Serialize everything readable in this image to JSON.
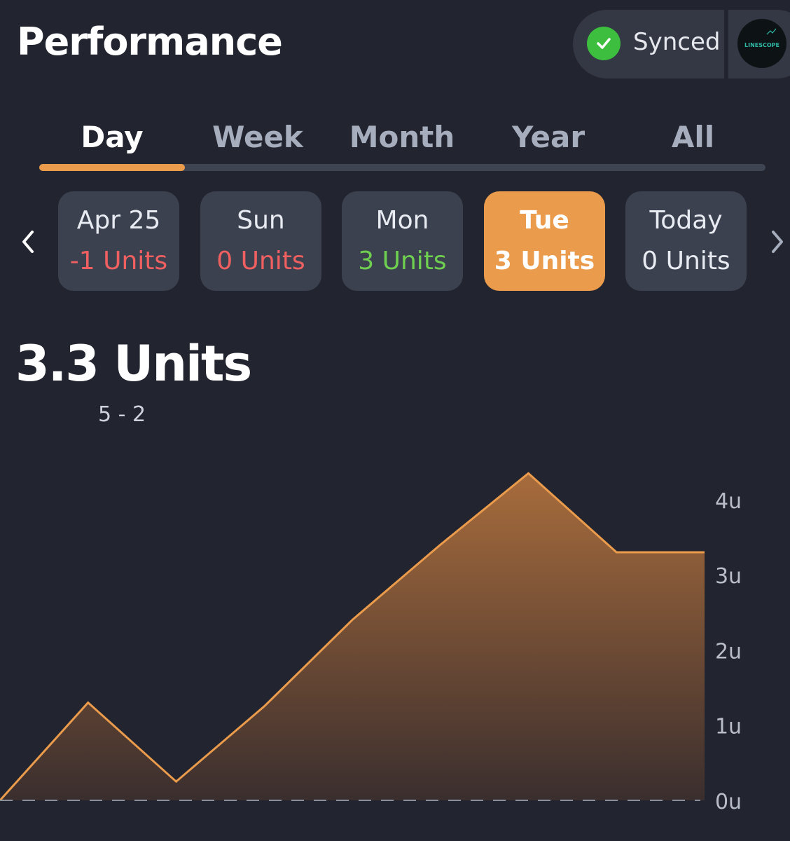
{
  "header": {
    "title": "Performance"
  },
  "sync": {
    "label": "Synced",
    "status_icon": "check-circle-icon",
    "status_color": "#3dbe3f"
  },
  "avatar": {
    "text": "LINESCOPE"
  },
  "tabs": [
    {
      "label": "Day",
      "active": true
    },
    {
      "label": "Week",
      "active": false
    },
    {
      "label": "Month",
      "active": false
    },
    {
      "label": "Year",
      "active": false
    },
    {
      "label": "All",
      "active": false
    }
  ],
  "days": [
    {
      "name": "Apr 25",
      "units": "-1 Units",
      "color": "#f06060"
    },
    {
      "name": "Sun",
      "units": "0 Units",
      "color": "#f06060"
    },
    {
      "name": "Mon",
      "units": "3 Units",
      "color": "#6fd04f"
    },
    {
      "name": "Tue",
      "units": "3 Units",
      "color": "#ffffff",
      "selected": true
    },
    {
      "name": "Today",
      "units": "0 Units",
      "color": "#e8ebf1"
    }
  ],
  "summary": {
    "units": "3.3 Units",
    "record": "5 - 2"
  },
  "colors": {
    "accent": "#ea9b4b",
    "background": "#22252f"
  },
  "chart_data": {
    "type": "area",
    "x": [
      0,
      1,
      2,
      3,
      4,
      5,
      6,
      7,
      8
    ],
    "values": [
      0,
      1.3,
      0.25,
      1.25,
      2.4,
      3.4,
      4.35,
      3.3,
      3.3
    ],
    "ylim": [
      0,
      4.4
    ],
    "y_ticks": [
      {
        "value": 0,
        "label": "0u"
      },
      {
        "value": 1,
        "label": "1u"
      },
      {
        "value": 2,
        "label": "2u"
      },
      {
        "value": 3,
        "label": "3u"
      },
      {
        "value": 4,
        "label": "4u"
      }
    ],
    "baseline_dashed": true
  }
}
